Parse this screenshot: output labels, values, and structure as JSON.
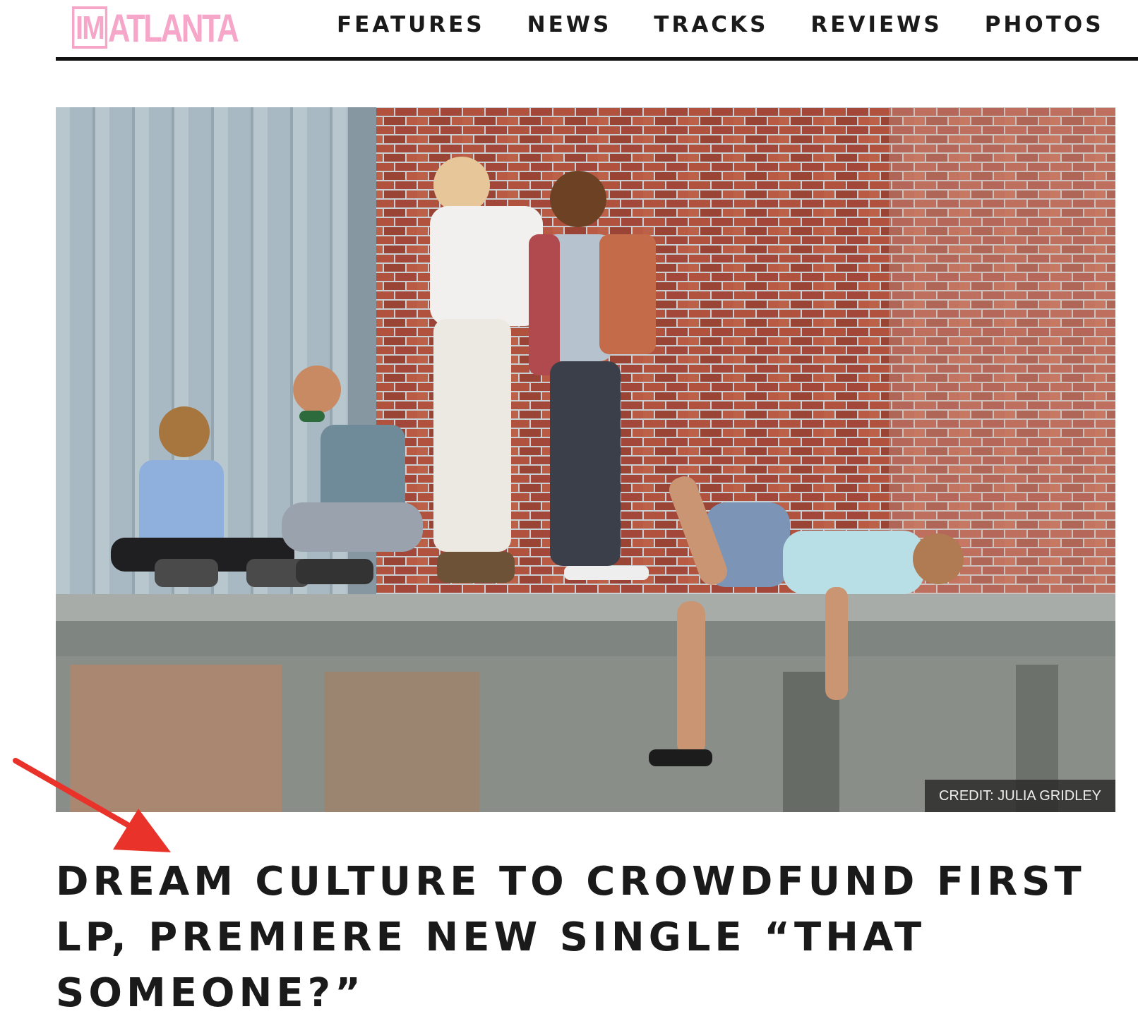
{
  "header": {
    "logo_mark": "IM",
    "logo_city": "ATLANTA",
    "nav": [
      "FEATURES",
      "NEWS",
      "TRACKS",
      "REVIEWS",
      "PHOTOS"
    ]
  },
  "hero": {
    "credit": "CREDIT: JULIA GRIDLEY"
  },
  "article": {
    "headline": "DREAM CULTURE TO CROWDFUND FIRST LP, PREMIERE NEW SINGLE “THAT SOMEONE?”"
  },
  "colors": {
    "brand_pink": "#f6a6c8",
    "arrow_red": "#e8322a",
    "text": "#1a1a1a"
  }
}
